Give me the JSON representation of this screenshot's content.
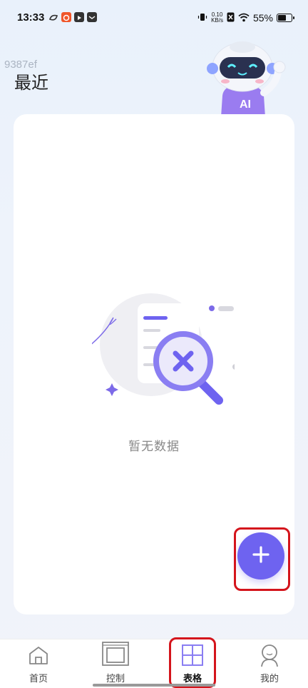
{
  "status_bar": {
    "time": "13:33",
    "net_speed_value": "0.10",
    "net_speed_unit": "KB/s",
    "battery_percent": "55%"
  },
  "watermark": "9387ef",
  "header": {
    "title": "最近"
  },
  "empty_state": {
    "message": "暂无数据"
  },
  "fab": {
    "icon": "plus-icon"
  },
  "tabs": [
    {
      "label": "首页",
      "icon": "home-icon",
      "active": false
    },
    {
      "label": "控制",
      "icon": "control-icon",
      "active": false
    },
    {
      "label": "表格",
      "icon": "table-icon",
      "active": true
    },
    {
      "label": "我的",
      "icon": "profile-icon",
      "active": false
    }
  ],
  "colors": {
    "accent": "#6e63f0",
    "highlight": "#d4141c"
  }
}
